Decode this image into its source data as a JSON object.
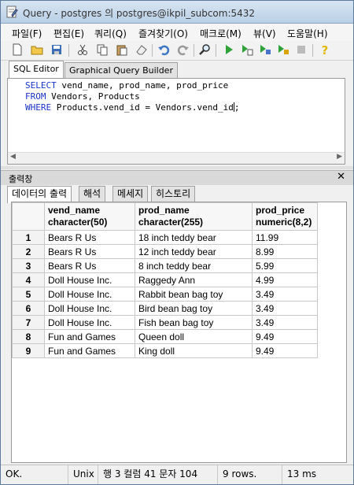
{
  "window": {
    "title": "Query - postgres 의 postgres@ikpil_subcom:5432"
  },
  "menubar": [
    "파일(F)",
    "편집(E)",
    "쿼리(Q)",
    "즐겨찾기(O)",
    "매크로(M)",
    "뷰(V)",
    "도움말(H)"
  ],
  "toolbar": {
    "icons": [
      "new-file-icon",
      "open-folder-icon",
      "save-icon",
      "cut-icon",
      "copy-icon",
      "paste-icon",
      "clear-icon",
      "undo-icon",
      "redo-icon",
      "find-icon",
      "execute-icon",
      "execute-to-file-icon",
      "explain-icon",
      "explain-analyze-icon",
      "cancel-icon",
      "help-icon"
    ]
  },
  "editor_tabs": [
    "SQL Editor",
    "Graphical Query Builder"
  ],
  "sql": {
    "line1_kw": "SELECT",
    "line1_rest": " vend_name, prod_name, prod_price",
    "line2_kw": "FROM",
    "line2_rest": " Vendors, Products",
    "line3_kw": "WHERE",
    "line3_rest": " Products.vend_id = Vendors.vend_id",
    "line3_end": ";"
  },
  "output_panel": {
    "title": "출력창",
    "close": "✕",
    "tabs": [
      "데이터의 출력",
      "해석",
      "메세지",
      "히스토리"
    ]
  },
  "grid": {
    "columns": [
      {
        "name": "vend_name",
        "type": "character(50)"
      },
      {
        "name": "prod_name",
        "type": "character(255)"
      },
      {
        "name": "prod_price",
        "type": "numeric(8,2)"
      }
    ],
    "rows": [
      [
        "1",
        "Bears R Us",
        "18 inch teddy bear",
        "11.99"
      ],
      [
        "2",
        "Bears R Us",
        "12 inch teddy bear",
        "8.99"
      ],
      [
        "3",
        "Bears R Us",
        "8 inch teddy bear",
        "5.99"
      ],
      [
        "4",
        "Doll House Inc.",
        "Raggedy Ann",
        "4.99"
      ],
      [
        "5",
        "Doll House Inc.",
        "Rabbit bean bag toy",
        "3.49"
      ],
      [
        "6",
        "Doll House Inc.",
        "Bird bean bag toy",
        "3.49"
      ],
      [
        "7",
        "Doll House Inc.",
        "Fish bean bag toy",
        "3.49"
      ],
      [
        "8",
        "Fun and Games",
        "Queen doll",
        "9.49"
      ],
      [
        "9",
        "Fun and Games",
        "King doll",
        "9.49"
      ]
    ]
  },
  "statusbar": {
    "state": "OK.",
    "lineend": "Unix",
    "position": "행 3 컬럼 41 문자 104",
    "rows": "9 rows.",
    "time": "13 ms"
  }
}
